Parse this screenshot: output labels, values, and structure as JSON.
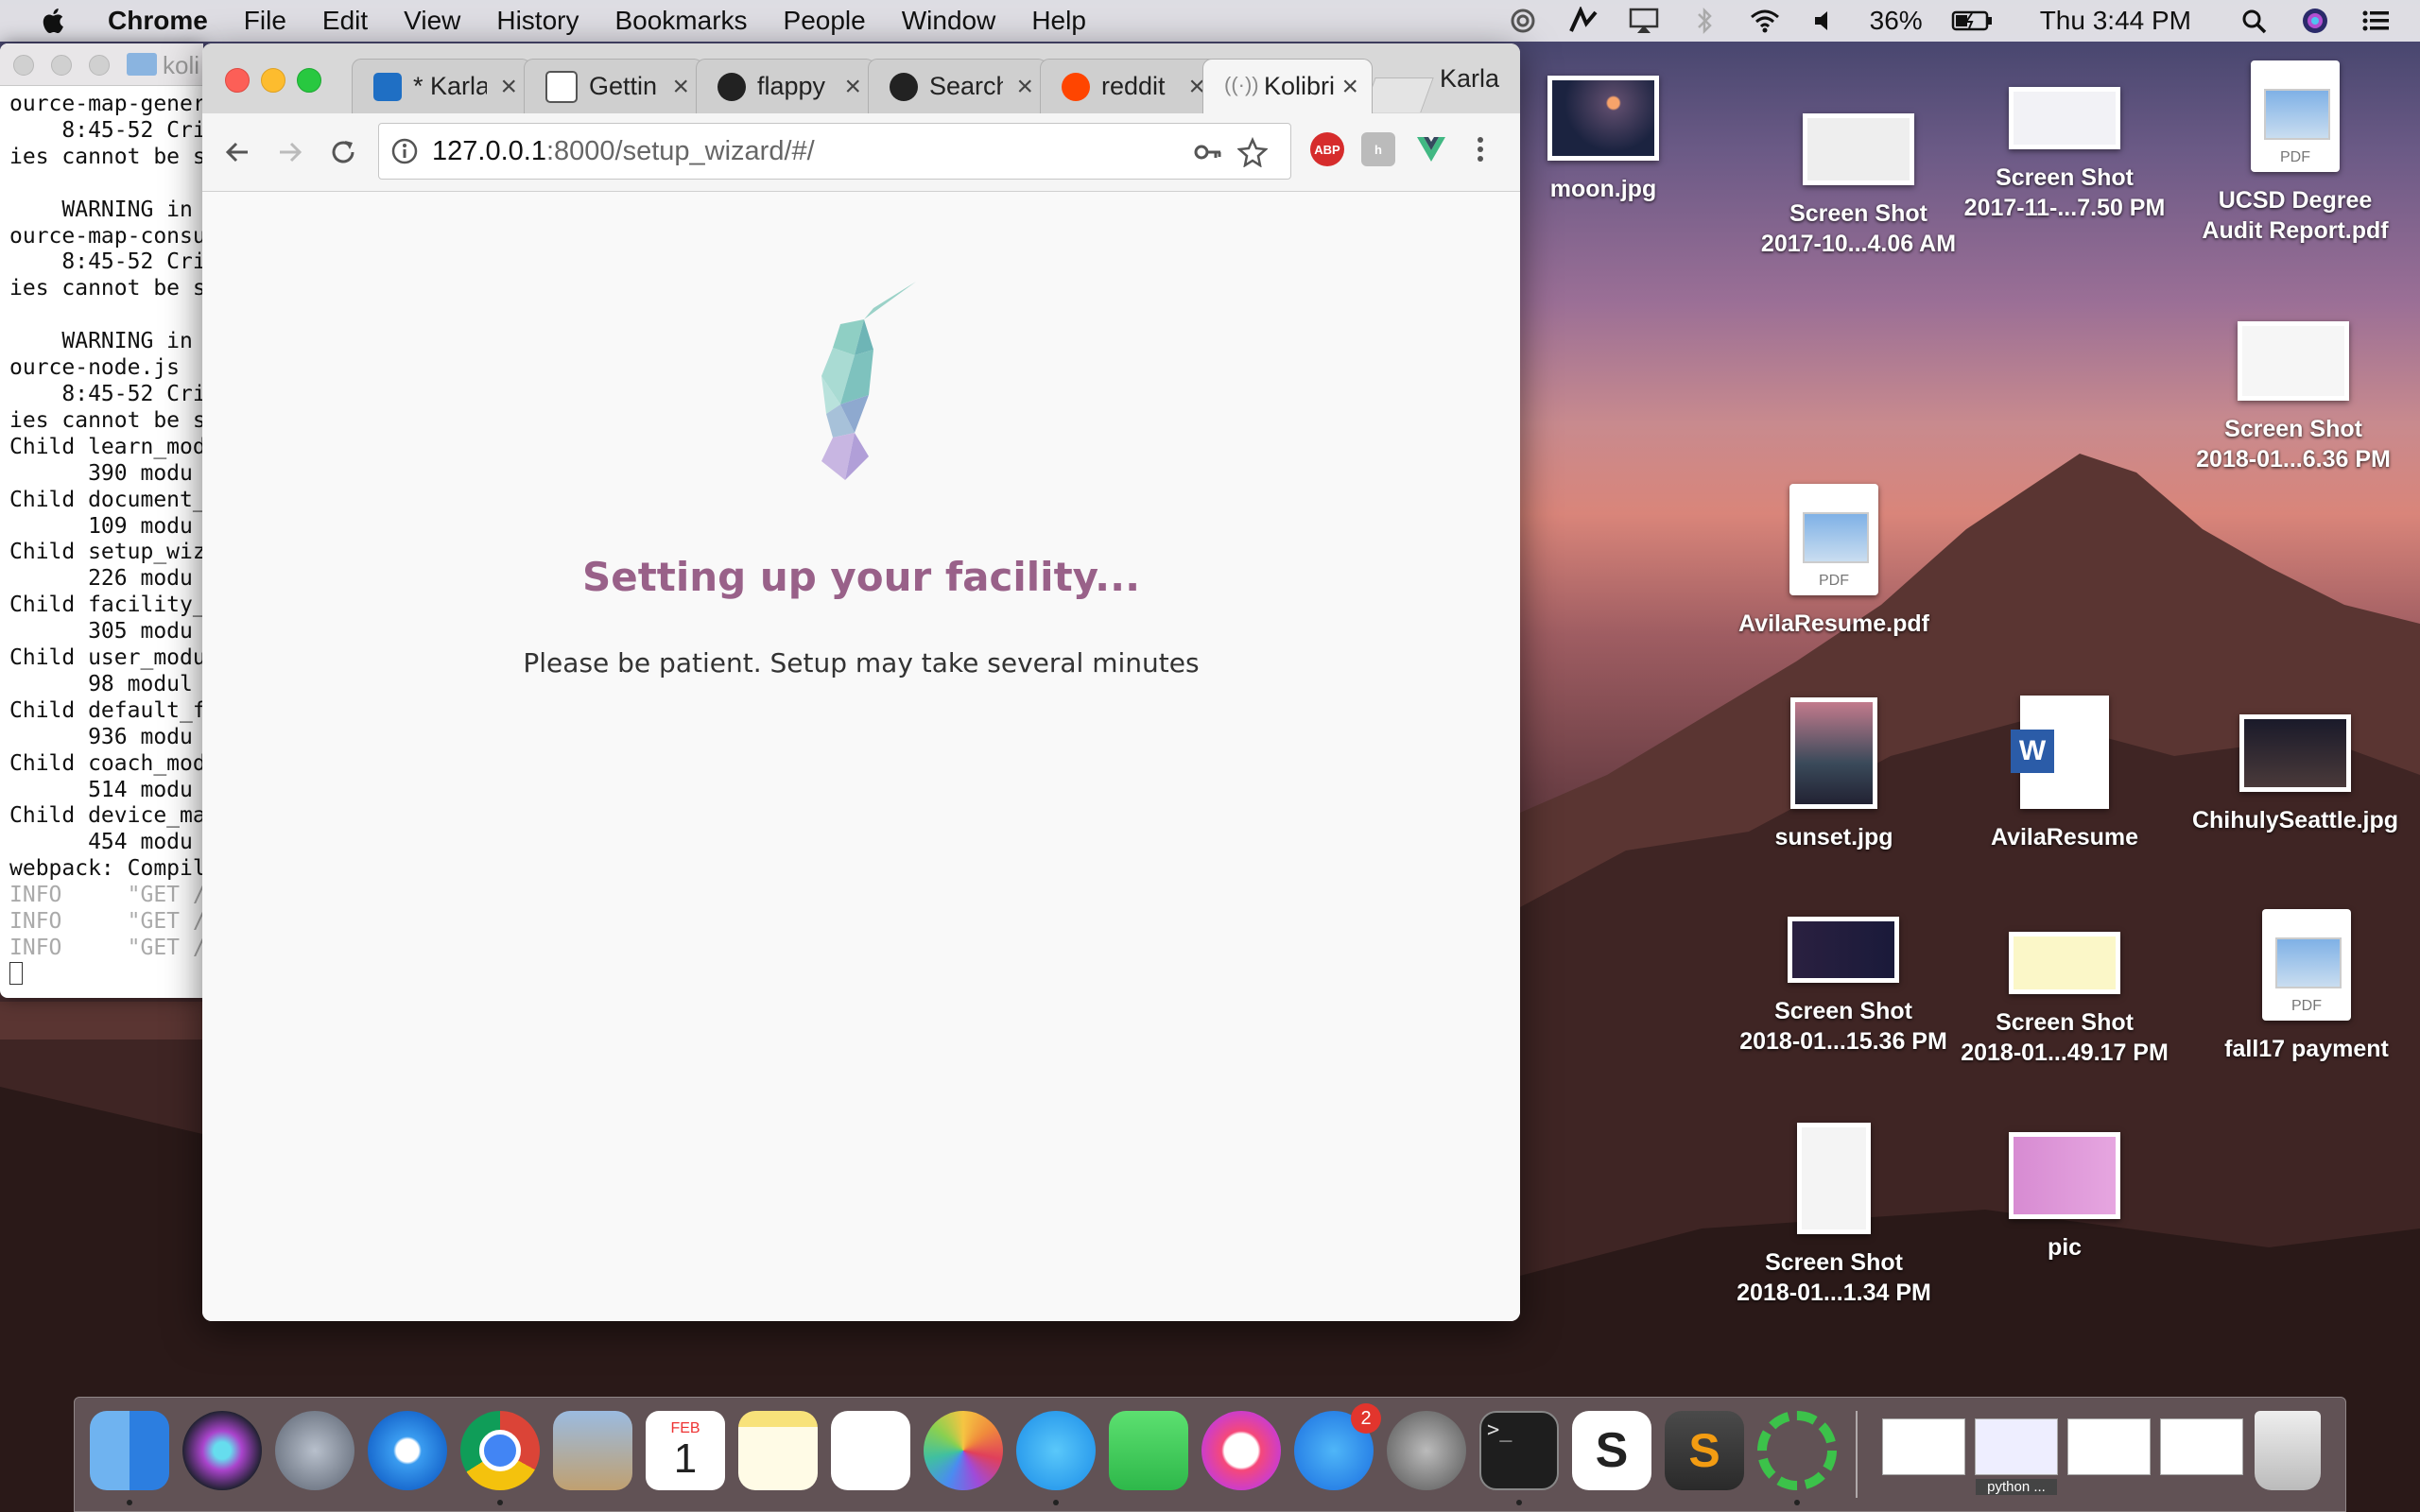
{
  "menubar": {
    "app": "Chrome",
    "items": [
      "File",
      "Edit",
      "View",
      "History",
      "Bookmarks",
      "People",
      "Window",
      "Help"
    ],
    "battery": "36%",
    "clock": "Thu 3:44 PM"
  },
  "terminal": {
    "title": "koli",
    "lines": [
      "ource-map-gener",
      "    8:45-52 Cri",
      "ies cannot be s",
      "",
      "    WARNING in",
      "ource-map-consu",
      "    8:45-52 Cri",
      "ies cannot be s",
      "",
      "    WARNING in",
      "ource-node.js",
      "    8:45-52 Cri",
      "ies cannot be s",
      "Child learn_mod",
      "      390 modu",
      "Child document_",
      "      109 modu",
      "Child setup_wiz",
      "      226 modu",
      "Child facility_",
      "      305 modu",
      "Child user_modu",
      "      98 modul",
      "Child default_f",
      "      936 modu",
      "Child coach_mod",
      "      514 modu",
      "Child device_ma",
      "      454 modu",
      "webpack: Compil"
    ],
    "info_lines": [
      "INFO     \"GET /",
      "INFO     \"GET /",
      "INFO     \"GET /"
    ]
  },
  "browser": {
    "tabs": [
      {
        "label": "* Karla",
        "color": "#1f6fc4"
      },
      {
        "label": "Gettin",
        "color": "#555555"
      },
      {
        "label": "flappy",
        "color": "#222222"
      },
      {
        "label": "Search",
        "color": "#222222"
      },
      {
        "label": "reddit",
        "color": "#ff4500"
      },
      {
        "label": "Kolibri",
        "color": "#888888"
      }
    ],
    "profile": "Karla",
    "url_host": "127.0.0.1",
    "url_path": ":8000/setup_wizard/#/",
    "extensions": [
      "ABP"
    ]
  },
  "page": {
    "heading": "Setting up your facility...",
    "subtext": "Please be patient. Setup may take several minutes",
    "accent": "#996189"
  },
  "desktop": {
    "icons": [
      {
        "l1": "moon.jpg",
        "l2": ""
      },
      {
        "l1": "Screen Shot",
        "l2": "2017-10...4.06 AM"
      },
      {
        "l1": "Screen Shot",
        "l2": "2017-11-...7.50 PM"
      },
      {
        "l1": "UCSD Degree",
        "l2": "Audit Report.pdf"
      },
      {
        "l1": "Screen Shot",
        "l2": "2018-01...6.36 PM"
      },
      {
        "l1": "AvilaResume.pdf",
        "l2": ""
      },
      {
        "l1": "sunset.jpg",
        "l2": ""
      },
      {
        "l1": "AvilaResume",
        "l2": ""
      },
      {
        "l1": "ChihulySeattle.jpg",
        "l2": ""
      },
      {
        "l1": "Screen Shot",
        "l2": "2018-01...15.36 PM"
      },
      {
        "l1": "Screen Shot",
        "l2": "2018-01...49.17 PM"
      },
      {
        "l1": "fall17 payment",
        "l2": ""
      },
      {
        "l1": "Screen Shot",
        "l2": "2018-01...1.34 PM"
      },
      {
        "l1": "pic",
        "l2": ""
      }
    ],
    "pdf_label": "PDF"
  },
  "dock": {
    "appstore_badge": "2",
    "calendar_month": "FEB",
    "calendar_day": "1",
    "mini_label": "python ..."
  }
}
